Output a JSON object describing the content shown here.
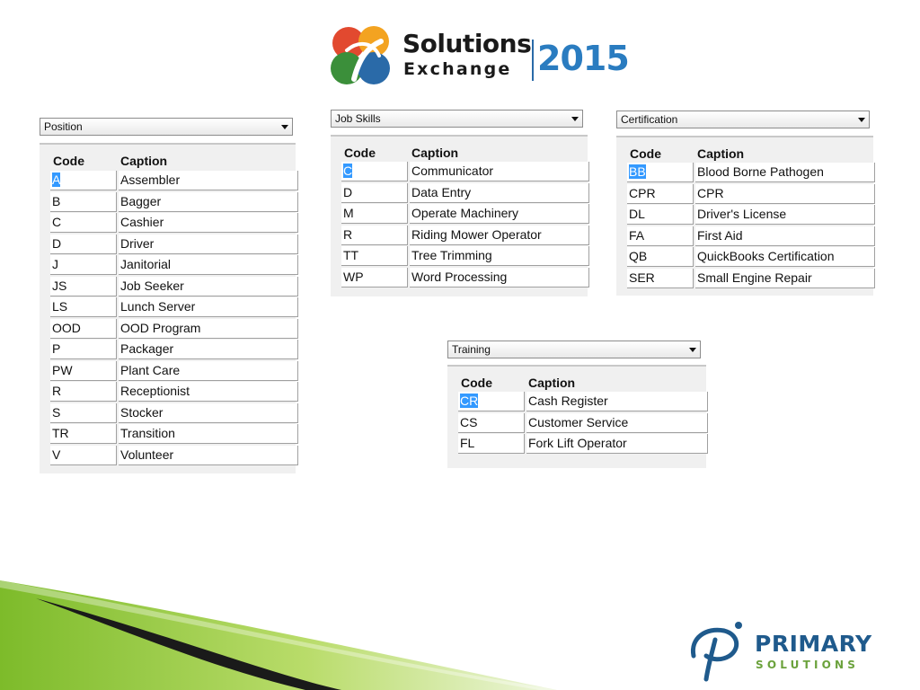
{
  "header": {
    "logo_line1": "Solutions",
    "logo_line2": "Exchange",
    "logo_year": "2015"
  },
  "footer": {
    "logo_line1": "PRIMARY",
    "logo_line2": "SOLUTIONS"
  },
  "colors": {
    "selection": "#3399ff",
    "brand_blue": "#1f5a8c",
    "brand_green": "#6ba23c"
  },
  "panels": {
    "position": {
      "dropdown": "Position",
      "col_code": "Code",
      "col_caption": "Caption",
      "rows": [
        {
          "code": "A",
          "caption": "Assembler"
        },
        {
          "code": "B",
          "caption": "Bagger"
        },
        {
          "code": "C",
          "caption": "Cashier"
        },
        {
          "code": "D",
          "caption": "Driver"
        },
        {
          "code": "J",
          "caption": "Janitorial"
        },
        {
          "code": "JS",
          "caption": "Job Seeker"
        },
        {
          "code": "LS",
          "caption": "Lunch Server"
        },
        {
          "code": "OOD",
          "caption": "OOD Program"
        },
        {
          "code": "P",
          "caption": "Packager"
        },
        {
          "code": "PW",
          "caption": "Plant Care"
        },
        {
          "code": "R",
          "caption": "Receptionist"
        },
        {
          "code": "S",
          "caption": "Stocker"
        },
        {
          "code": "TR",
          "caption": "Transition"
        },
        {
          "code": "V",
          "caption": "Volunteer"
        }
      ]
    },
    "job_skills": {
      "dropdown": "Job Skills",
      "col_code": "Code",
      "col_caption": "Caption",
      "rows": [
        {
          "code": "C",
          "caption": "Communicator"
        },
        {
          "code": "D",
          "caption": "Data Entry"
        },
        {
          "code": "M",
          "caption": "Operate Machinery"
        },
        {
          "code": "R",
          "caption": "Riding Mower Operator"
        },
        {
          "code": "TT",
          "caption": "Tree Trimming"
        },
        {
          "code": "WP",
          "caption": "Word Processing"
        }
      ]
    },
    "certification": {
      "dropdown": "Certification",
      "col_code": "Code",
      "col_caption": "Caption",
      "rows": [
        {
          "code": "BB",
          "caption": "Blood Borne Pathogen"
        },
        {
          "code": "CPR",
          "caption": "CPR"
        },
        {
          "code": "DL",
          "caption": "Driver's License"
        },
        {
          "code": "FA",
          "caption": "First Aid"
        },
        {
          "code": "QB",
          "caption": "QuickBooks Certification"
        },
        {
          "code": "SER",
          "caption": "Small Engine Repair"
        }
      ]
    },
    "training": {
      "dropdown": "Training",
      "col_code": "Code",
      "col_caption": "Caption",
      "rows": [
        {
          "code": "CR",
          "caption": "Cash Register"
        },
        {
          "code": "CS",
          "caption": "Customer Service"
        },
        {
          "code": "FL",
          "caption": "Fork Lift Operator"
        }
      ]
    }
  }
}
